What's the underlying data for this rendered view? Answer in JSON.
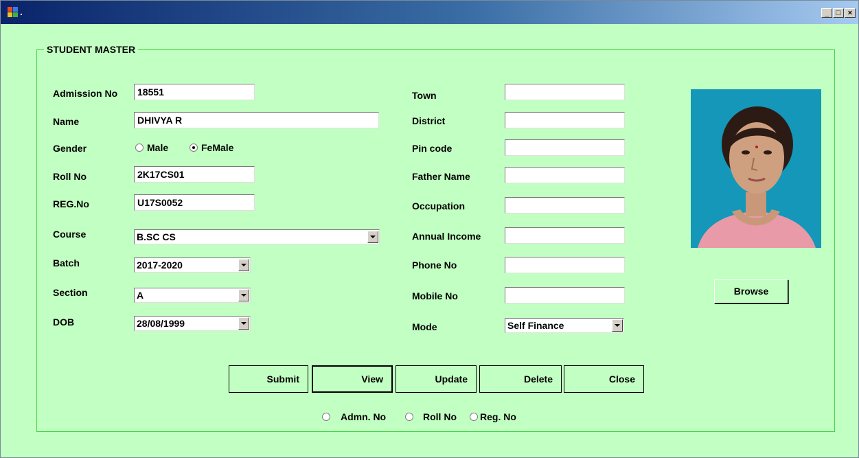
{
  "window": {
    "title": "."
  },
  "title_controls": {
    "minimize": "_",
    "maximize": "□",
    "close": "×"
  },
  "group": {
    "legend": "STUDENT MASTER"
  },
  "left_fields": {
    "admission_no": {
      "label": "Admission No",
      "value": "18551"
    },
    "name": {
      "label": "Name",
      "value": "DHIVYA R"
    },
    "gender": {
      "label": "Gender",
      "options": [
        "Male",
        "FeMale"
      ],
      "selected": "FeMale"
    },
    "roll_no": {
      "label": "Roll No",
      "value": "2K17CS01"
    },
    "reg_no": {
      "label": "REG.No",
      "value": "U17S0052"
    },
    "course": {
      "label": "Course",
      "value": "B.SC CS"
    },
    "batch": {
      "label": "Batch",
      "value": "2017-2020"
    },
    "section": {
      "label": "Section",
      "value": "A"
    },
    "dob": {
      "label": "DOB",
      "value": "28/08/1999"
    }
  },
  "right_fields": {
    "town": {
      "label": "Town",
      "value": ""
    },
    "district": {
      "label": "District",
      "value": ""
    },
    "pin_code": {
      "label": "Pin code",
      "value": ""
    },
    "father_name": {
      "label": "Father Name",
      "value": ""
    },
    "occupation": {
      "label": "Occupation",
      "value": ""
    },
    "annual_income": {
      "label": "Annual Income",
      "value": ""
    },
    "phone_no": {
      "label": "Phone No",
      "value": ""
    },
    "mobile_no": {
      "label": "Mobile No",
      "value": ""
    },
    "mode": {
      "label": "Mode",
      "value": "Self Finance"
    }
  },
  "buttons": {
    "submit": "Submit",
    "view": "View",
    "update": "Update",
    "delete": "Delete",
    "close": "Close",
    "browse": "Browse"
  },
  "search_options": [
    "Admn. No",
    "Roll No",
    "Reg. No"
  ],
  "colors": {
    "background": "#c2ffc2",
    "group_border": "#45d645",
    "titlebar_start": "#0a246a",
    "titlebar_end": "#a6caf0"
  },
  "icons": {
    "app": "windows-form-icon",
    "photo": "student-photo"
  }
}
